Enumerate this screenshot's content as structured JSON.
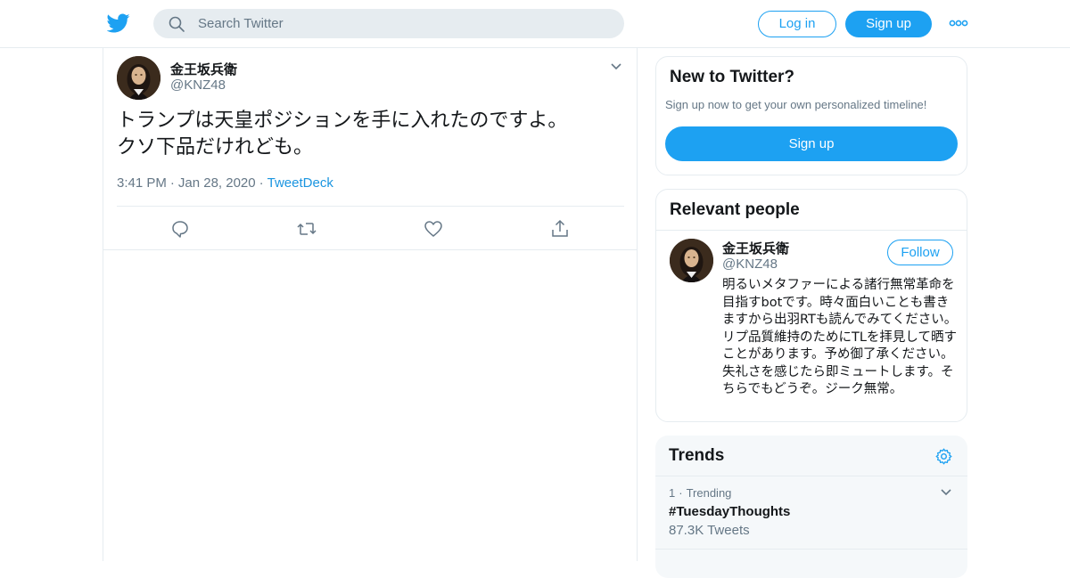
{
  "header": {
    "logo_icon": "twitter-bird-icon",
    "search": {
      "placeholder": "Search Twitter",
      "icon": "search-icon"
    },
    "login_label": "Log in",
    "signup_label": "Sign up",
    "more_icon": "more-dots-icon"
  },
  "tweet": {
    "author_name": "金王坂兵衛",
    "author_handle": "@KNZ48",
    "text": "トランプは天皇ポジションを手に入れたのですよ。\nクソ下品だけれども。",
    "time": "3:41 PM",
    "date": "Jan 28, 2020",
    "source": "TweetDeck",
    "actions": [
      "reply-icon",
      "retweet-icon",
      "like-icon",
      "share-icon"
    ]
  },
  "sidebar": {
    "new_to_twitter": {
      "title": "New to Twitter?",
      "subtitle": "Sign up now to get your own personalized timeline!",
      "signup_label": "Sign up"
    },
    "relevant_people": {
      "title": "Relevant people",
      "person": {
        "name": "金王坂兵衛",
        "handle": "@KNZ48",
        "follow_label": "Follow",
        "bio": "明るいメタファーによる諸行無常革命を目指すbotです。時々面白いことも書きますから出羽RTも読んでみてください。リプ品質維持のためにTLを拝見して晒すことがあります。予め御了承ください。失礼さを感じたら即ミュートします。そちらでもどうぞ。ジーク無常。"
      }
    },
    "trends": {
      "title": "Trends",
      "settings_icon": "gear-icon",
      "items": [
        {
          "rank": "1",
          "context": "Trending",
          "name": "#TuesdayThoughts",
          "count": "87.3K Tweets"
        }
      ]
    }
  },
  "colors": {
    "accent": "#1da1f2",
    "text_primary": "#14171a",
    "text_secondary": "#657786",
    "border": "#e6ecf0"
  }
}
